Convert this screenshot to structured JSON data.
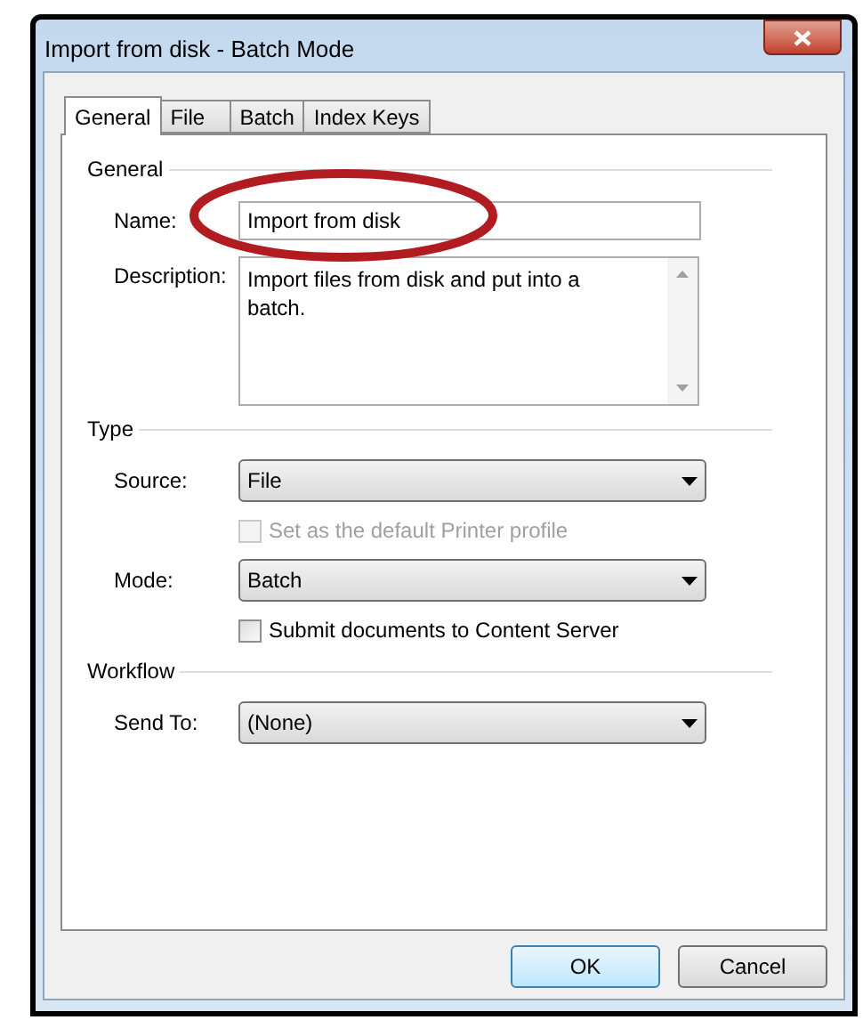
{
  "window": {
    "title": "Import from disk - Batch Mode"
  },
  "tabs": [
    {
      "label": "General",
      "selected": true
    },
    {
      "label": "File",
      "selected": false
    },
    {
      "label": "Batch",
      "selected": false
    },
    {
      "label": "Index Keys",
      "selected": false
    }
  ],
  "sections": [
    {
      "title": "General",
      "fields": [
        {
          "kind": "text",
          "label": "Name:",
          "value": "Import from disk"
        },
        {
          "kind": "textarea",
          "label": "Description:",
          "value": "Import files from disk and put into a batch."
        }
      ]
    },
    {
      "title": "Type",
      "fields": [
        {
          "kind": "dropdown",
          "label": "Source:",
          "value": "File"
        },
        {
          "kind": "checkbox",
          "label": "Set as the default Printer profile",
          "checked": false,
          "disabled": true
        },
        {
          "kind": "dropdown",
          "label": "Mode:",
          "value": "Batch"
        },
        {
          "kind": "checkbox",
          "label": "Submit documents to Content Server",
          "checked": false,
          "disabled": false
        }
      ]
    },
    {
      "title": "Workflow",
      "fields": [
        {
          "kind": "dropdown",
          "label": "Send To:",
          "value": "(None)"
        }
      ]
    }
  ],
  "buttons": [
    {
      "label": "OK",
      "default": true
    },
    {
      "label": "Cancel",
      "default": false
    }
  ]
}
